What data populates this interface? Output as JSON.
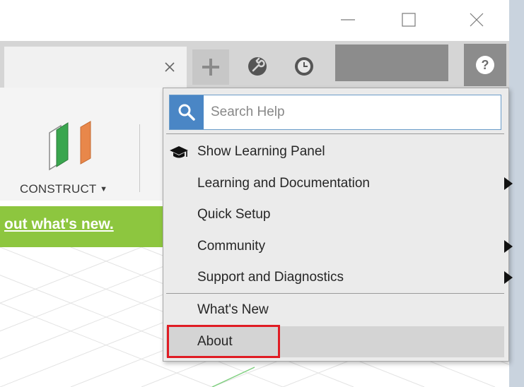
{
  "window_controls": {
    "minimize_icon": "minimize-icon",
    "maximize_icon": "maximize-icon",
    "close_icon": "close-icon"
  },
  "tabbar": {
    "close_tab_icon": "close-tab-icon",
    "new_tab_icon": "plus-icon",
    "extensions_icon": "wrench-icon",
    "job_status_icon": "clock-icon",
    "help_icon": "question-icon"
  },
  "toolbar": {
    "construct_label": "CONSTRUCT"
  },
  "banner": {
    "link_text": "out what's new."
  },
  "help_menu": {
    "search": {
      "placeholder": "Search Help"
    },
    "items": [
      {
        "label": "Show Learning Panel",
        "icon": "graduation-cap-icon",
        "submenu": false
      },
      {
        "label": "Learning and Documentation",
        "submenu": true
      },
      {
        "label": "Quick Setup",
        "submenu": false
      },
      {
        "label": "Community",
        "submenu": true
      },
      {
        "label": "Support and Diagnostics",
        "submenu": true
      }
    ],
    "footer_items": [
      {
        "label": "What's New"
      },
      {
        "label": "About",
        "highlighted": true
      }
    ]
  },
  "colors": {
    "banner_green": "#8dc63f",
    "search_blue": "#4a86c5",
    "highlight_red": "#e01c24"
  }
}
